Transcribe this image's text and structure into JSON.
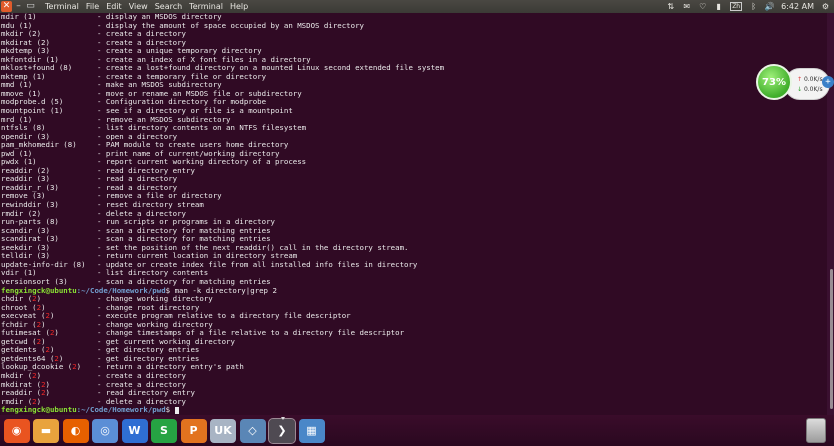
{
  "menubar": {
    "menus": [
      "Terminal",
      "File",
      "Edit",
      "View",
      "Search",
      "Terminal",
      "Help"
    ],
    "tray": {
      "keyboard": "Zh",
      "clock": "6:42 AM"
    }
  },
  "terminal": {
    "lines": [
      {
        "name": "mdir (1)",
        "desc": "- display an MSDOS directory"
      },
      {
        "name": "mdu (1)",
        "desc": "- display the amount of space occupied by an MSDOS directory"
      },
      {
        "name": "mkdir (2)",
        "desc": "- create a directory"
      },
      {
        "name": "mkdirat (2)",
        "desc": "- create a directory"
      },
      {
        "name": "mkdtemp (3)",
        "desc": "- create a unique temporary directory"
      },
      {
        "name": "mkfontdir (1)",
        "desc": "- create an index of X font files in a directory"
      },
      {
        "name": "mklost+found (8)",
        "desc": "- create a lost+found directory on a mounted Linux second extended file system"
      },
      {
        "name": "mktemp (1)",
        "desc": "- create a temporary file or directory"
      },
      {
        "name": "mmd (1)",
        "desc": "- make an MSDOS subdirectory"
      },
      {
        "name": "mmove (1)",
        "desc": "- move or rename an MSDOS file or subdirectory"
      },
      {
        "name": "modprobe.d (5)",
        "desc": "- Configuration directory for modprobe"
      },
      {
        "name": "mountpoint (1)",
        "desc": "- see if a directory or file is a mountpoint"
      },
      {
        "name": "mrd (1)",
        "desc": "- remove an MSDOS subdirectory"
      },
      {
        "name": "ntfsls (8)",
        "desc": "- list directory contents on an NTFS filesystem"
      },
      {
        "name": "opendir (3)",
        "desc": "- open a directory"
      },
      {
        "name": "pam_mkhomedir (8)",
        "desc": "- PAM module to create users home directory"
      },
      {
        "name": "pwd (1)",
        "desc": "- print name of current/working directory"
      },
      {
        "name": "pwdx (1)",
        "desc": "- report current working directory of a process"
      },
      {
        "name": "readdir (2)",
        "desc": "- read directory entry"
      },
      {
        "name": "readdir (3)",
        "desc": "- read a directory"
      },
      {
        "name": "readdir_r (3)",
        "desc": "- read a directory"
      },
      {
        "name": "remove (3)",
        "desc": "- remove a file or directory"
      },
      {
        "name": "rewinddir (3)",
        "desc": "- reset directory stream"
      },
      {
        "name": "rmdir (2)",
        "desc": "- delete a directory"
      },
      {
        "name": "run-parts (8)",
        "desc": "- run scripts or programs in a directory"
      },
      {
        "name": "scandir (3)",
        "desc": "- scan a directory for matching entries"
      },
      {
        "name": "scandirat (3)",
        "desc": "- scan a directory for matching entries"
      },
      {
        "name": "seekdir (3)",
        "desc": "- set the position of the next readdir() call in the directory stream."
      },
      {
        "name": "telldir (3)",
        "desc": "- return current location in directory stream"
      },
      {
        "name": "update-info-dir (8)",
        "desc": "- update or create index file from all installed info files in directory"
      },
      {
        "name": "vdir (1)",
        "desc": "- list directory contents"
      },
      {
        "name": "versionsort (3)",
        "desc": "- scan a directory for matching entries"
      }
    ],
    "prompt_user": "fengxingck@ubuntu",
    "prompt_path": ":~/Code/Homework/pwd",
    "prompt_suffix": "$ ",
    "command": "man -k directory|grep 2",
    "grep_lines": [
      {
        "name": "chdir",
        "sec": "2",
        "desc": "- change working directory"
      },
      {
        "name": "chroot",
        "sec": "2",
        "desc": "- change root directory"
      },
      {
        "name": "execveat",
        "sec": "2",
        "desc": "- execute program relative to a directory file descriptor"
      },
      {
        "name": "fchdir",
        "sec": "2",
        "desc": "- change working directory"
      },
      {
        "name": "futimesat",
        "sec": "2",
        "desc": "- change timestamps of a file relative to a directory file descriptor"
      },
      {
        "name": "getcwd",
        "sec": "2",
        "desc": "- get current working directory"
      },
      {
        "name": "getdents",
        "sec": "2",
        "desc": "- get directory entries"
      },
      {
        "name": "getdents64",
        "sec": "2",
        "desc": "- get directory entries"
      },
      {
        "name": "lookup_dcookie",
        "sec": "2",
        "desc": "- return a directory entry's path"
      },
      {
        "name": "mkdir",
        "sec": "2",
        "desc": "- create a directory"
      },
      {
        "name": "mkdirat",
        "sec": "2",
        "desc": "- create a directory"
      },
      {
        "name": "readdir",
        "sec": "2",
        "desc": "- read directory entry"
      },
      {
        "name": "rmdir",
        "sec": "2",
        "desc": "- delete a directory"
      }
    ]
  },
  "netwidget": {
    "percent": "73%",
    "up": "0.0K/s",
    "down": "0.0K/s"
  },
  "dock": {
    "apps": [
      {
        "icon": "ubuntu-logo-icon",
        "color": "#e95420",
        "glyph": "◉"
      },
      {
        "icon": "files-icon",
        "color": "#e8a33d",
        "glyph": "▬"
      },
      {
        "icon": "firefox-icon",
        "color": "#e66000",
        "glyph": "◐"
      },
      {
        "icon": "browser-icon",
        "color": "#5b8ed6",
        "glyph": "◎"
      },
      {
        "icon": "wps-writer-icon",
        "color": "#2f6ed3",
        "glyph": "W"
      },
      {
        "icon": "wps-spreadsheet-icon",
        "color": "#26a343",
        "glyph": "S"
      },
      {
        "icon": "wps-presentation-icon",
        "color": "#e2731f",
        "glyph": "P"
      },
      {
        "icon": "ubuntu-one-icon",
        "color": "#a8b4c4",
        "glyph": "UK"
      },
      {
        "icon": "system-monitor-icon",
        "color": "#5a86b6",
        "glyph": "◇"
      },
      {
        "icon": "terminal-icon",
        "color": "#4f4a52",
        "glyph": "❯"
      },
      {
        "icon": "workspace-switcher-icon",
        "color": "#4a87c8",
        "glyph": "▦"
      }
    ],
    "active_index": 9
  }
}
